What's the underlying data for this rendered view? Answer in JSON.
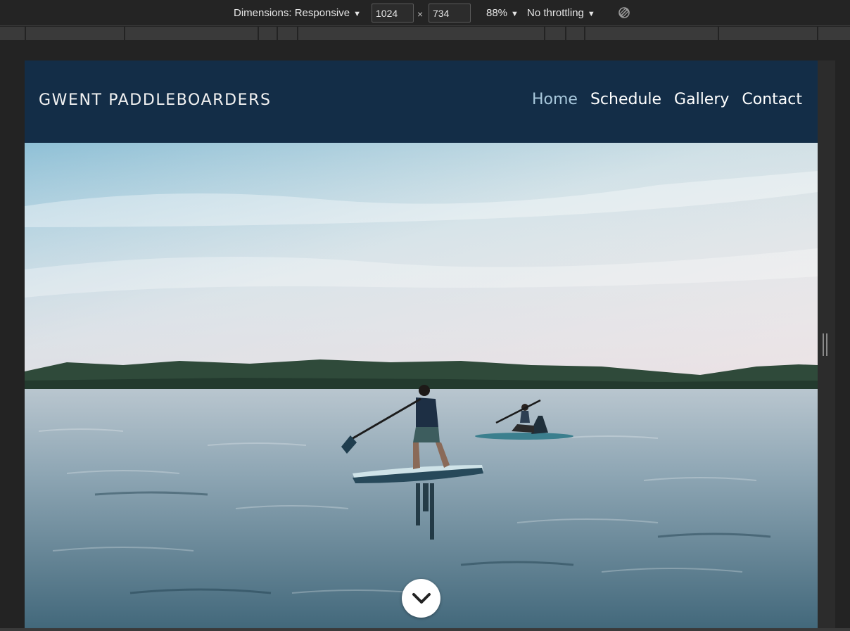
{
  "devtools": {
    "dimensions_label": "Dimensions: Responsive",
    "caret": "▼",
    "width_value": "1024",
    "height_value": "734",
    "times_symbol": "×",
    "zoom": "88%",
    "throttling": "No throttling",
    "rotate_icon": "rotate-icon"
  },
  "site": {
    "brand": "GWENT PADDLEBOARDERS",
    "nav": [
      {
        "label": "Home",
        "active": true
      },
      {
        "label": "Schedule",
        "active": false
      },
      {
        "label": "Gallery",
        "active": false
      },
      {
        "label": "Contact",
        "active": false
      }
    ],
    "scroll_down_icon": "chevron-down-icon"
  },
  "colors": {
    "header_bg": "#132d47",
    "active_nav": "#a8c8dc",
    "devtools_bg": "#242424"
  }
}
